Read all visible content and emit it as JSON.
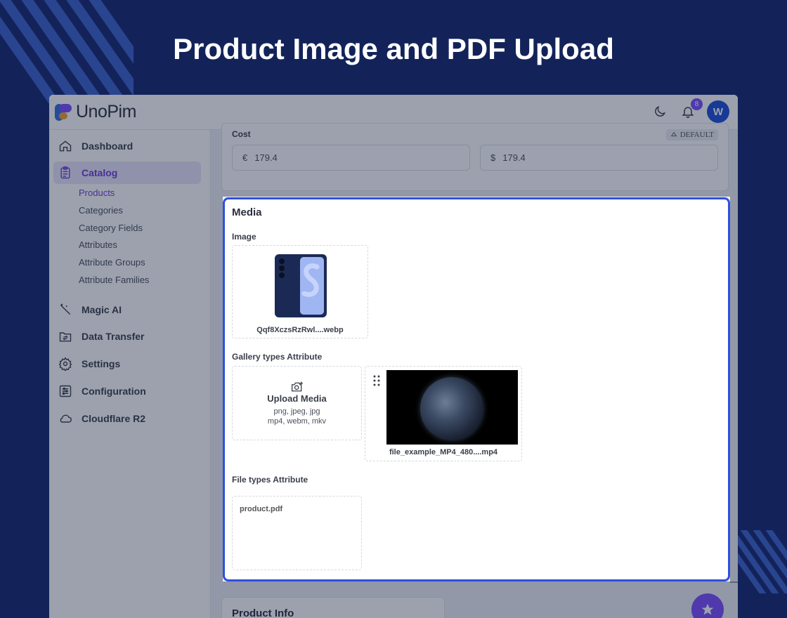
{
  "banner": {
    "title": "Product Image and PDF Upload"
  },
  "app": {
    "logo_text": "UnoPim",
    "notifications_count": "8",
    "avatar_initial": "W"
  },
  "sidebar": {
    "items": [
      {
        "label": "Dashboard",
        "icon": "home-icon"
      },
      {
        "label": "Catalog",
        "icon": "clipboard-icon"
      },
      {
        "label": "Magic AI",
        "icon": "magic-wand-icon"
      },
      {
        "label": "Data Transfer",
        "icon": "folder-transfer-icon"
      },
      {
        "label": "Settings",
        "icon": "gear-icon"
      },
      {
        "label": "Configuration",
        "icon": "sliders-icon"
      },
      {
        "label": "Cloudflare R2",
        "icon": "cloud-icon"
      }
    ],
    "catalog_sub": [
      "Products",
      "Categories",
      "Category Fields",
      "Attributes",
      "Attribute Groups",
      "Attribute Families"
    ]
  },
  "cost": {
    "label": "Cost",
    "scope_badge": "DEFAULT",
    "eur_symbol": "€",
    "eur_value": "179.4",
    "usd_symbol": "$",
    "usd_value": "179.4"
  },
  "media": {
    "title": "Media",
    "image_label": "Image",
    "image_file": "Qqf8XczsRzRwl....webp",
    "gallery_label": "Gallery types Attribute",
    "upload_title": "Upload Media",
    "upload_formats_1": "png, jpeg, jpg",
    "upload_formats_2": "mp4, webm, mkv",
    "video_file": "file_example_MP4_480....mp4",
    "file_label": "File types Attribute",
    "file_name": "product.pdf"
  },
  "product_info": {
    "title": "Product Info"
  },
  "colors": {
    "accent": "#7c4dff",
    "focus_border": "#2f4fe0",
    "banner_bg": "#13235a"
  }
}
